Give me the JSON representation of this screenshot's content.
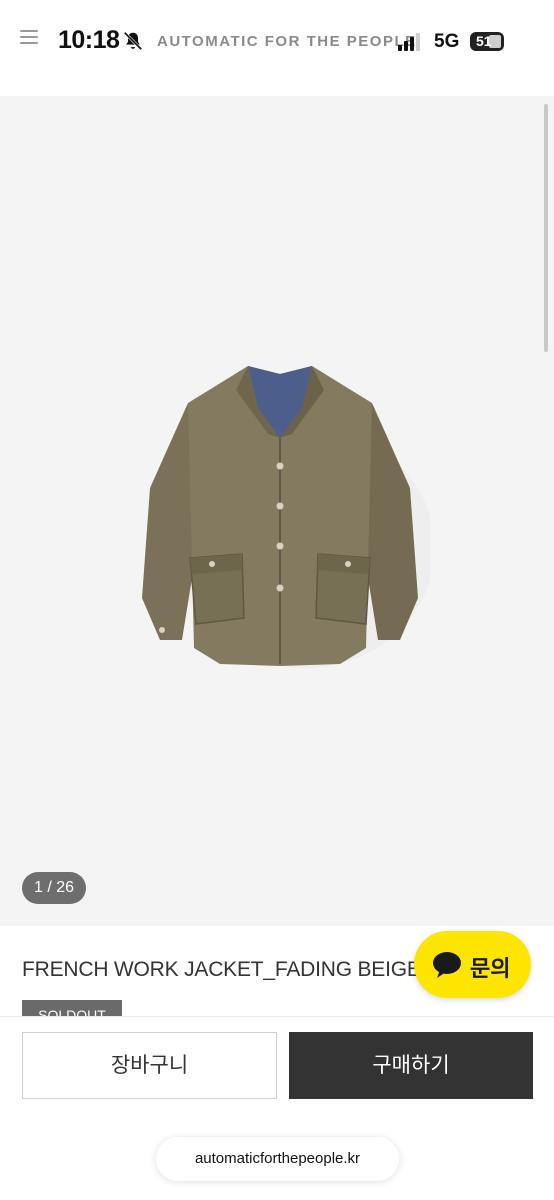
{
  "status_bar": {
    "time": "10:18",
    "brand_title": "AUTOMATIC FOR THE PEOPLE",
    "network": "5G",
    "battery": "51"
  },
  "gallery": {
    "counter": "1 / 26",
    "product_image": "jacket-photo"
  },
  "product": {
    "title": "FRENCH WORK JACKET_FADING BEIGE",
    "badge": "SOLDOUT"
  },
  "chat": {
    "label": "문의",
    "color": "#FEE500"
  },
  "actions": {
    "cart_label": "장바구니",
    "buy_label": "구매하기"
  },
  "browser": {
    "url": "automaticforthepeople.kr"
  },
  "colors": {
    "buy_button": "#333333",
    "soldout_badge": "#6A6A6A",
    "image_background": "#F4F4F4"
  },
  "icons": [
    "menu-icon",
    "bell-off-icon",
    "signal-icon",
    "battery-icon",
    "chat-bubble-icon"
  ]
}
